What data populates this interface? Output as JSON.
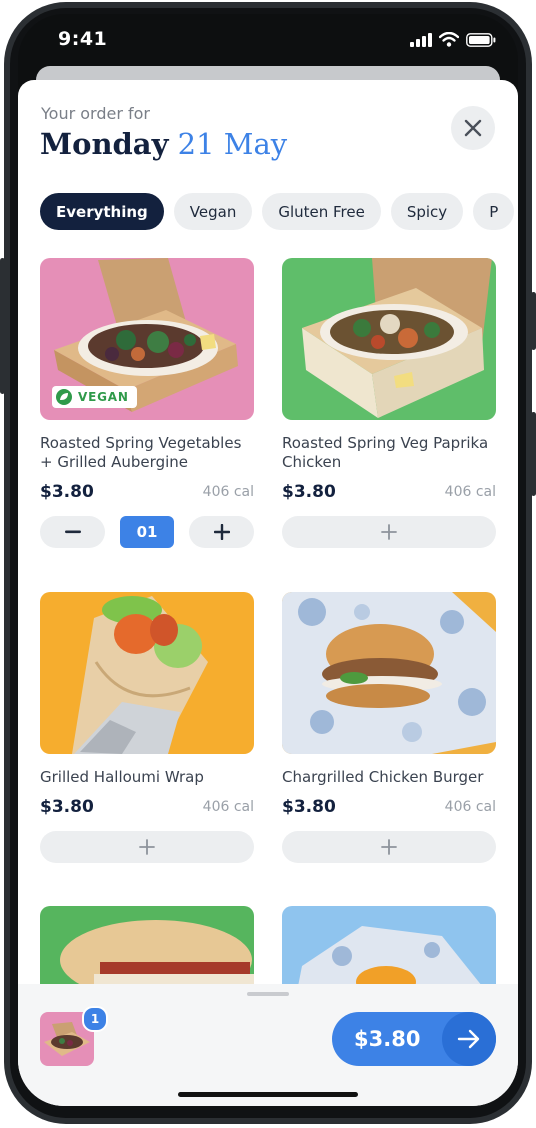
{
  "status_bar": {
    "time": "9:41"
  },
  "header": {
    "eyebrow": "Your order for",
    "day": "Monday",
    "date": "21 May"
  },
  "filters": [
    {
      "label": "Everything",
      "active": true
    },
    {
      "label": "Vegan",
      "active": false
    },
    {
      "label": "Gluten Free",
      "active": false
    },
    {
      "label": "Spicy",
      "active": false
    },
    {
      "label": "P",
      "active": false
    }
  ],
  "items": [
    {
      "name": "Roasted Spring Vegetables + Grilled Aubergine",
      "price": "$3.80",
      "calories": "406 cal",
      "badge": "VEGAN",
      "quantity": "01",
      "image_bg": "#e58fb7"
    },
    {
      "name": "Roasted Spring Veg Paprika Chicken",
      "price": "$3.80",
      "calories": "406 cal",
      "image_bg": "#5fbe6a"
    },
    {
      "name": "Grilled Halloumi Wrap",
      "price": "$3.80",
      "calories": "406 cal",
      "image_bg": "#f6ad2e"
    },
    {
      "name": "Chargrilled Chicken Burger",
      "price": "$3.80",
      "calories": "406 cal",
      "image_bg": "#f0b040"
    },
    {
      "name": "",
      "image_bg": "#56b55e"
    },
    {
      "name": "",
      "image_bg": "#8fc4ee"
    }
  ],
  "basket": {
    "count": "1",
    "total": "$3.80"
  },
  "colors": {
    "navy": "#13213e",
    "accent": "#3d82e6",
    "chip_bg": "#eceef0"
  },
  "icons": {
    "close": "close-icon",
    "add": "plus-icon",
    "remove": "minus-icon",
    "checkout": "arrow-right-icon",
    "vegan": "leaf-icon"
  }
}
